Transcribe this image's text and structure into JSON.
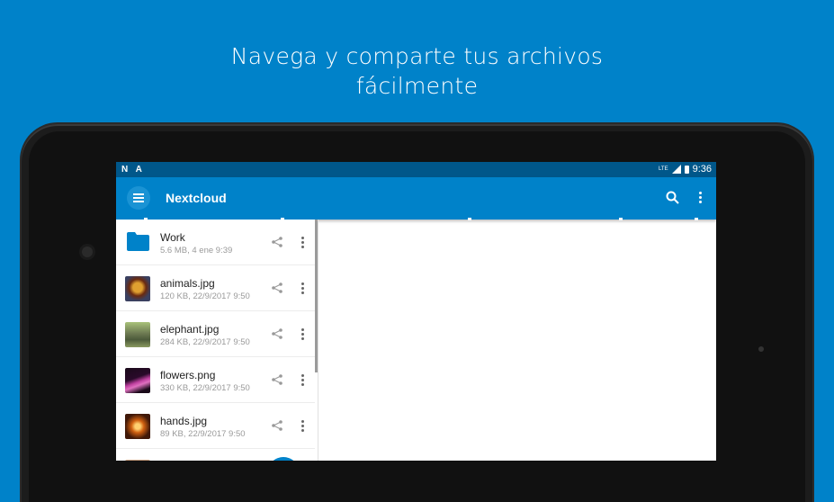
{
  "promo": {
    "line1": "Navega y comparte tus archivos",
    "line2": "fácilmente"
  },
  "statusbar": {
    "left_icons": [
      "N",
      "A"
    ],
    "network": "LTE",
    "time": "9:36"
  },
  "toolbar": {
    "title": "Nextcloud",
    "icons": [
      "menu-icon",
      "search-icon",
      "more-vert-icon"
    ]
  },
  "files": [
    {
      "name": "Work",
      "meta": "5.6 MB, 4 ene 9:39",
      "type": "folder"
    },
    {
      "name": "animals.jpg",
      "meta": "120 KB, 22/9/2017 9:50",
      "type": "image"
    },
    {
      "name": "elephant.jpg",
      "meta": "284 KB, 22/9/2017 9:50",
      "type": "image"
    },
    {
      "name": "flowers.png",
      "meta": "330 KB, 22/9/2017 9:50",
      "type": "image"
    },
    {
      "name": "hands.jpg",
      "meta": "89 KB, 22/9/2017 9:50",
      "type": "image"
    }
  ],
  "colors": {
    "brand": "#0082c9",
    "statusbar": "#00578a",
    "background": "#0082c9"
  }
}
